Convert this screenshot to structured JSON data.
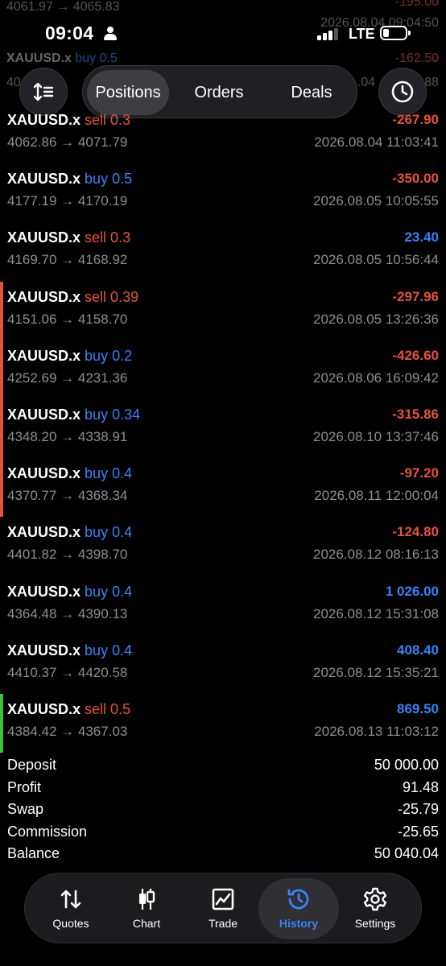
{
  "status_bar": {
    "time": "09:04",
    "network": "LTE"
  },
  "ghost_rows": [
    {
      "left": "4061.97 → 4065.83",
      "right": "2026.08.04 09:04:50",
      "profit": "-195.00"
    },
    {
      "symbol": "XAUUSD.x",
      "side": "buy 0.5",
      "left": "40",
      "right": ".04",
      "right2": "88",
      "profit": "-162.50"
    }
  ],
  "header": {
    "tabs": [
      {
        "label": "Positions",
        "active": true
      },
      {
        "label": "Orders",
        "active": false
      },
      {
        "label": "Deals",
        "active": false
      }
    ]
  },
  "deals": [
    {
      "symbol": "XAUUSD.x",
      "side": "sell 0.3",
      "prices": "4062.86 → 4071.79",
      "profit": "-267.90",
      "date": "2026.08.04 11:03:41",
      "marker": ""
    },
    {
      "symbol": "XAUUSD.x",
      "side": "buy 0.5",
      "prices": "4177.19 → 4170.19",
      "profit": "-350.00",
      "date": "2026.08.05 10:05:55",
      "marker": ""
    },
    {
      "symbol": "XAUUSD.x",
      "side": "sell 0.3",
      "prices": "4169.70 → 4168.92",
      "profit": "23.40",
      "date": "2026.08.05 10:56:44",
      "marker": ""
    },
    {
      "symbol": "XAUUSD.x",
      "side": "sell 0.39",
      "prices": "4151.06 → 4158.70",
      "profit": "-297.96",
      "date": "2026.08.05 13:26:36",
      "marker": "#e5533d"
    },
    {
      "symbol": "XAUUSD.x",
      "side": "buy 0.2",
      "prices": "4252.69 → 4231.36",
      "profit": "-426.60",
      "date": "2026.08.06 16:09:42",
      "marker": "#e5533d"
    },
    {
      "symbol": "XAUUSD.x",
      "side": "buy 0.34",
      "prices": "4348.20 → 4338.91",
      "profit": "-315.86",
      "date": "2026.08.10 13:37:46",
      "marker": "#e5533d"
    },
    {
      "symbol": "XAUUSD.x",
      "side": "buy 0.4",
      "prices": "4370.77 → 4368.34",
      "profit": "-97.20",
      "date": "2026.08.11 12:00:04",
      "marker": "#e5533d"
    },
    {
      "symbol": "XAUUSD.x",
      "side": "buy 0.4",
      "prices": "4401.82 → 4398.70",
      "profit": "-124.80",
      "date": "2026.08.12 08:16:13",
      "marker": ""
    },
    {
      "symbol": "XAUUSD.x",
      "side": "buy 0.4",
      "prices": "4364.48 → 4390.13",
      "profit": "1 026.00",
      "date": "2026.08.12 15:31:08",
      "marker": ""
    },
    {
      "symbol": "XAUUSD.x",
      "side": "buy 0.4",
      "prices": "4410.37 → 4420.58",
      "profit": "408.40",
      "date": "2026.08.12 15:35:21",
      "marker": ""
    },
    {
      "symbol": "XAUUSD.x",
      "side": "sell 0.5",
      "prices": "4384.42 → 4367.03",
      "profit": "869.50",
      "date": "2026.08.13 11:03:12",
      "marker": "#3fbf3f"
    }
  ],
  "summary": [
    {
      "label": "Deposit",
      "value": "50 000.00"
    },
    {
      "label": "Profit",
      "value": "91.48"
    },
    {
      "label": "Swap",
      "value": "-25.79"
    },
    {
      "label": "Commission",
      "value": "-25.65"
    },
    {
      "label": "Balance",
      "value": "50 040.04"
    }
  ],
  "bottom_nav": [
    {
      "label": "Quotes",
      "icon": "quotes-icon",
      "active": false
    },
    {
      "label": "Chart",
      "icon": "chart-icon",
      "active": false
    },
    {
      "label": "Trade",
      "icon": "trade-icon",
      "active": false
    },
    {
      "label": "History",
      "icon": "history-icon",
      "active": true
    },
    {
      "label": "Settings",
      "icon": "settings-icon",
      "active": false
    }
  ],
  "colors": {
    "buy": "#3b82f6",
    "sell": "#e5533d",
    "profit_positive": "#3b82f6",
    "profit_negative": "#e5533d",
    "accent": "#3b82f6"
  }
}
